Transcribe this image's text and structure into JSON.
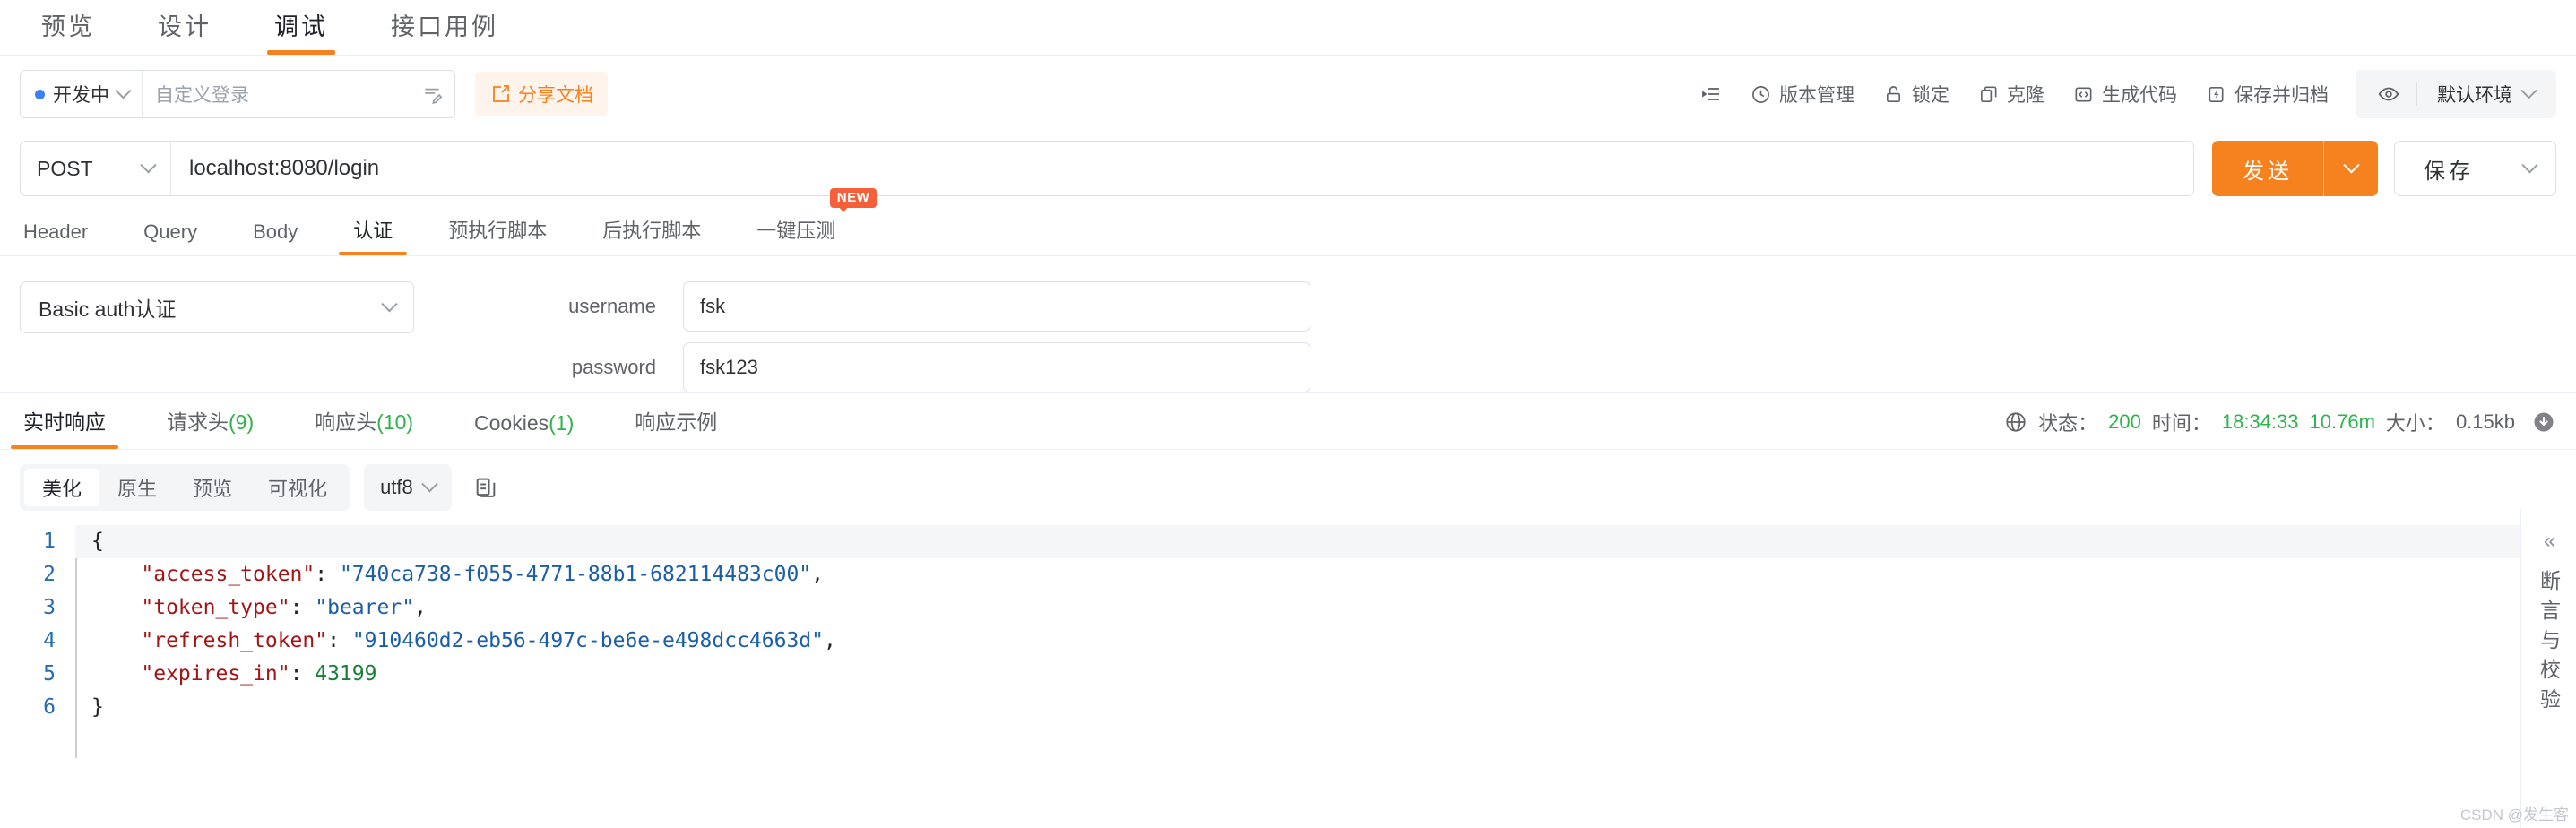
{
  "top_tabs": [
    {
      "label": "预览",
      "active": false
    },
    {
      "label": "设计",
      "active": false
    },
    {
      "label": "调试",
      "active": true
    },
    {
      "label": "接口用例",
      "active": false
    }
  ],
  "meta": {
    "status_label": "开发中",
    "status_dot_color": "#3a7ffb",
    "name_value": "自定义登录",
    "share_label": "分享文档",
    "accent_color": "#f5811f",
    "tools": [
      {
        "label": "",
        "icon": "list-icon"
      },
      {
        "label": "版本管理",
        "icon": "clock-icon"
      },
      {
        "label": "锁定",
        "icon": "lock-icon"
      },
      {
        "label": "克隆",
        "icon": "copy-icon"
      },
      {
        "label": "生成代码",
        "icon": "code-icon"
      },
      {
        "label": "保存并归档",
        "icon": "archive-icon"
      }
    ],
    "environment": "默认环境"
  },
  "request": {
    "method": "POST",
    "url": "localhost:8080/login",
    "send_label": "发送",
    "save_label": "保存",
    "tabs": [
      {
        "label": "Header",
        "active": false,
        "badge": ""
      },
      {
        "label": "Query",
        "active": false,
        "badge": ""
      },
      {
        "label": "Body",
        "active": false,
        "badge": ""
      },
      {
        "label": "认证",
        "active": true,
        "badge": ""
      },
      {
        "label": "预执行脚本",
        "active": false,
        "badge": ""
      },
      {
        "label": "后执行脚本",
        "active": false,
        "badge": ""
      },
      {
        "label": "一键压测",
        "active": false,
        "badge": "NEW"
      }
    ]
  },
  "auth": {
    "type": "Basic auth认证",
    "fields": [
      {
        "label": "username",
        "value": "fsk"
      },
      {
        "label": "password",
        "value": "fsk123"
      }
    ]
  },
  "response": {
    "tabs": [
      {
        "label": "实时响应",
        "count": "",
        "active": true
      },
      {
        "label": "请求头",
        "count": "(9)",
        "active": false
      },
      {
        "label": "响应头",
        "count": "(10)",
        "active": false
      },
      {
        "label": "Cookies",
        "count": "(1)",
        "active": false
      },
      {
        "label": "响应示例",
        "count": "",
        "active": false
      }
    ],
    "meta": {
      "status_label": "状态：",
      "status_value": "200",
      "time_label": "时间：",
      "time_value": "18:34:33",
      "duration_value": "10.76m",
      "size_label": "大小：",
      "size_value": "0.15kb",
      "success_color": "#2bb44a"
    },
    "view_modes": [
      {
        "label": "美化",
        "active": true
      },
      {
        "label": "原生",
        "active": false
      },
      {
        "label": "预览",
        "active": false
      },
      {
        "label": "可视化",
        "active": false
      }
    ],
    "encoding": "utf8",
    "body_lines": [
      {
        "num": "1",
        "tokens": [
          {
            "t": "{",
            "c": "p"
          }
        ]
      },
      {
        "num": "2",
        "tokens": [
          {
            "t": "    \"access_token\"",
            "c": "k"
          },
          {
            "t": ": ",
            "c": "p"
          },
          {
            "t": "\"740ca738-f055-4771-88b1-682114483c00\"",
            "c": "s"
          },
          {
            "t": ",",
            "c": "p"
          }
        ]
      },
      {
        "num": "3",
        "tokens": [
          {
            "t": "    \"token_type\"",
            "c": "k"
          },
          {
            "t": ": ",
            "c": "p"
          },
          {
            "t": "\"bearer\"",
            "c": "s"
          },
          {
            "t": ",",
            "c": "p"
          }
        ]
      },
      {
        "num": "4",
        "tokens": [
          {
            "t": "    \"refresh_token\"",
            "c": "k"
          },
          {
            "t": ": ",
            "c": "p"
          },
          {
            "t": "\"910460d2-eb56-497c-be6e-e498dcc4663d\"",
            "c": "s"
          },
          {
            "t": ",",
            "c": "p"
          }
        ]
      },
      {
        "num": "5",
        "tokens": [
          {
            "t": "    \"expires_in\"",
            "c": "k"
          },
          {
            "t": ": ",
            "c": "p"
          },
          {
            "t": "43199",
            "c": "n"
          }
        ]
      },
      {
        "num": "6",
        "tokens": [
          {
            "t": "}",
            "c": "p"
          }
        ]
      }
    ]
  },
  "right_sidebar": {
    "collapse_icon": "«",
    "label": "断言与校验"
  },
  "watermark": "CSDN @发生客"
}
